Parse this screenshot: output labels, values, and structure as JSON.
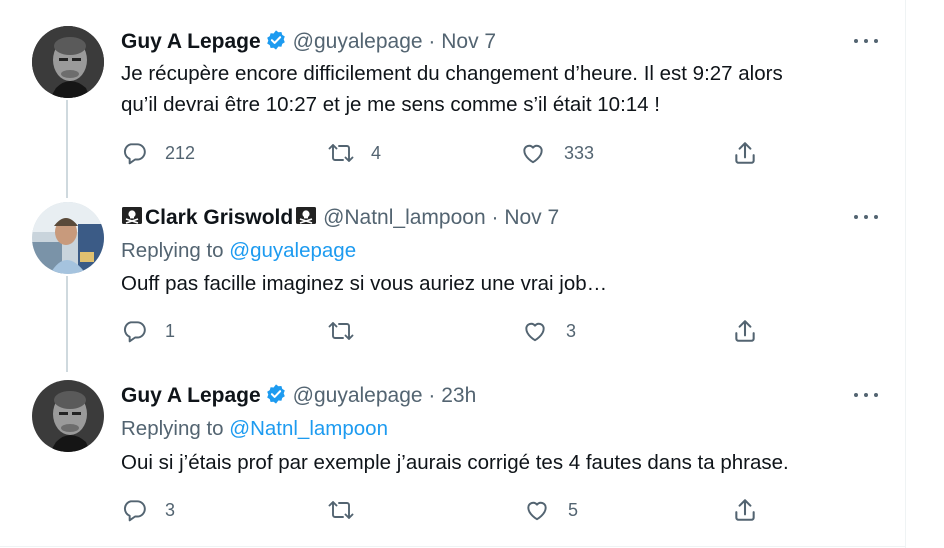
{
  "tweets": [
    {
      "name": "Guy A Lepage",
      "verified": true,
      "handle": "@guyalepage",
      "separator": "·",
      "time": "Nov 7",
      "replying_prefix": "",
      "replying_to": "",
      "lines": [
        "Je récupère encore difficilement du changement d’heure. Il est 9:27 alors",
        "qu’il devrai être 10:27 et je me sens comme s’il était 10:14 !"
      ],
      "replies": "212",
      "retweets": "4",
      "likes": "333"
    },
    {
      "name": "🏴‍☠️Clark Griswold🏴‍☠️",
      "name_core": "Clark Griswold",
      "verified": false,
      "handle": "@Natnl_lampoon",
      "separator": "·",
      "time": "Nov 7",
      "replying_prefix": "Replying to ",
      "replying_to": "@guyalepage",
      "lines": [
        "Ouff pas facille imaginez si vous auriez une vrai job…"
      ],
      "replies": "1",
      "retweets": "",
      "likes": "3"
    },
    {
      "name": "Guy A Lepage",
      "verified": true,
      "handle": "@guyalepage",
      "separator": "·",
      "time": "23h",
      "replying_prefix": "Replying to ",
      "replying_to": "@Natnl_lampoon",
      "lines": [
        "Oui si j’étais prof par exemple j’aurais corrigé tes 4 fautes dans ta phrase."
      ],
      "replies": "3",
      "retweets": "",
      "likes": "5"
    }
  ],
  "icons": {
    "reply": "reply-icon",
    "retweet": "retweet-icon",
    "like": "heart-icon",
    "share": "share-icon",
    "more": "more-icon",
    "verified": "verified-badge-icon",
    "pirate_flag": "pirate-flag-icon"
  },
  "colors": {
    "text": "#0f1419",
    "secondary": "#536471",
    "link": "#1d9bf0",
    "verified": "#1d9bf0",
    "thread_line": "#cfd9de"
  }
}
